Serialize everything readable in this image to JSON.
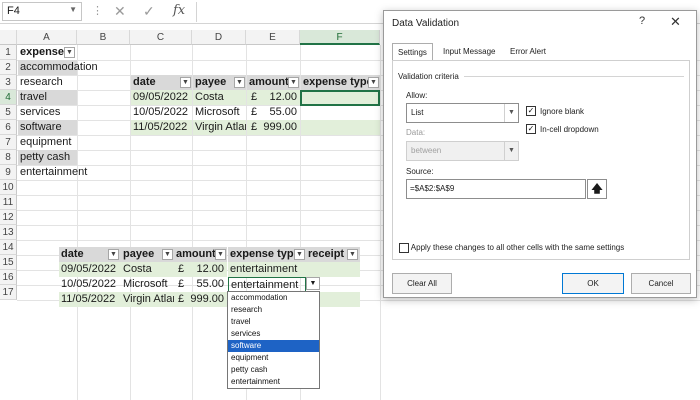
{
  "formula_bar": {
    "name_box": "F4",
    "fx_label": "fx"
  },
  "columns": [
    "A",
    "B",
    "C",
    "D",
    "E",
    "F"
  ],
  "rows": [
    "1",
    "2",
    "3",
    "4",
    "5",
    "6",
    "7",
    "8",
    "9",
    "10",
    "11",
    "12",
    "13",
    "14",
    "15",
    "16",
    "17"
  ],
  "list_a": {
    "header": "expenses",
    "items": [
      "accommodation",
      "research",
      "travel",
      "services",
      "software",
      "equipment",
      "petty cash",
      "entertainment"
    ]
  },
  "table1": {
    "headers": [
      "date",
      "payee",
      "amount",
      "expense type"
    ],
    "rows": [
      {
        "date": "09/05/2022",
        "payee": "Costa",
        "currency": "£",
        "amount": "12.00"
      },
      {
        "date": "10/05/2022",
        "payee": "Microsoft",
        "currency": "£",
        "amount": "55.00"
      },
      {
        "date": "11/05/2022",
        "payee": "Virgin Atlar",
        "currency": "£",
        "amount": "999.00"
      }
    ]
  },
  "table2": {
    "headers": [
      "date",
      "payee",
      "amount",
      "expense type",
      "receipt"
    ],
    "rows": [
      {
        "date": "09/05/2022",
        "payee": "Costa",
        "currency": "£",
        "amount": "12.00",
        "type": "entertainment"
      },
      {
        "date": "10/05/2022",
        "payee": "Microsoft",
        "currency": "£",
        "amount": "55.00",
        "type": "entertainment"
      },
      {
        "date": "11/05/2022",
        "payee": "Virgin Atlar",
        "currency": "£",
        "amount": "999.00",
        "type": ""
      }
    ]
  },
  "dropdown_options": [
    "accommodation",
    "research",
    "travel",
    "services",
    "software",
    "equipment",
    "petty cash",
    "entertainment"
  ],
  "dropdown_highlighted": "software",
  "dialog": {
    "title": "Data Validation",
    "help": "?",
    "close": "✕",
    "tabs": [
      "Settings",
      "Input Message",
      "Error Alert"
    ],
    "group_label": "Validation criteria",
    "allow_label": "Allow:",
    "allow_value": "List",
    "data_label": "Data:",
    "data_value": "between",
    "ignore_blank": "Ignore blank",
    "in_cell_dropdown": "In-cell dropdown",
    "source_label": "Source:",
    "source_value": "=$A$2:$A$9",
    "apply_text": "Apply these changes to all other cells with the same settings",
    "buttons": {
      "clear_all": "Clear All",
      "ok": "OK",
      "cancel": "Cancel"
    }
  },
  "colors": {
    "excel_green": "#217346",
    "header_grey": "#d9d9d9",
    "table_green": "#e2efda",
    "highlight_blue": "#1e63c5"
  }
}
